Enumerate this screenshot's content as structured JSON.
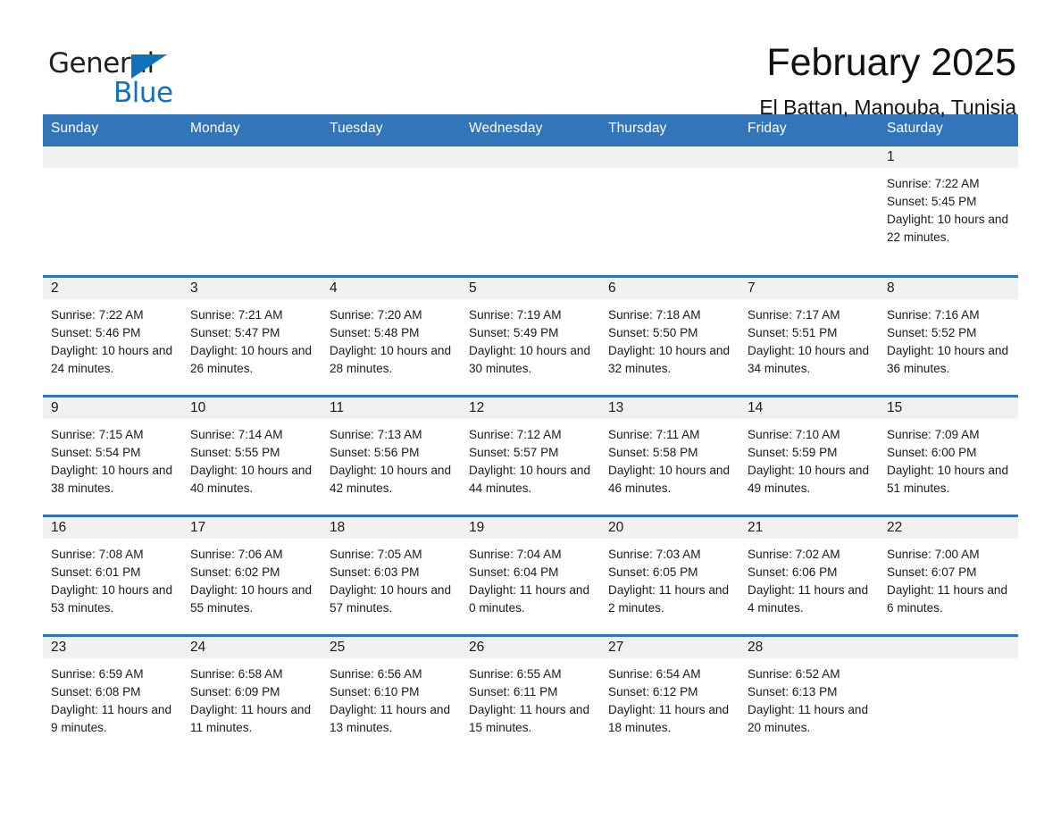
{
  "brand": {
    "name_part1": "General",
    "name_part2": "Blue",
    "triangle_color": "#1271bd"
  },
  "header": {
    "title": "February 2025",
    "location": "El Battan, Manouba, Tunisia"
  },
  "theme": {
    "header_blue": "#3275b8",
    "daynum_band": "#f1f1f1",
    "text": "#1a1a1a"
  },
  "calendar": {
    "weekdays": [
      "Sunday",
      "Monday",
      "Tuesday",
      "Wednesday",
      "Thursday",
      "Friday",
      "Saturday"
    ],
    "weeks": [
      [
        {
          "day": "",
          "sunrise": "",
          "sunset": "",
          "daylight": "",
          "empty": true
        },
        {
          "day": "",
          "sunrise": "",
          "sunset": "",
          "daylight": "",
          "empty": true
        },
        {
          "day": "",
          "sunrise": "",
          "sunset": "",
          "daylight": "",
          "empty": true
        },
        {
          "day": "",
          "sunrise": "",
          "sunset": "",
          "daylight": "",
          "empty": true
        },
        {
          "day": "",
          "sunrise": "",
          "sunset": "",
          "daylight": "",
          "empty": true
        },
        {
          "day": "",
          "sunrise": "",
          "sunset": "",
          "daylight": "",
          "empty": true
        },
        {
          "day": "1",
          "sunrise": "Sunrise: 7:22 AM",
          "sunset": "Sunset: 5:45 PM",
          "daylight": "Daylight: 10 hours and 22 minutes.",
          "empty": false
        }
      ],
      [
        {
          "day": "2",
          "sunrise": "Sunrise: 7:22 AM",
          "sunset": "Sunset: 5:46 PM",
          "daylight": "Daylight: 10 hours and 24 minutes.",
          "empty": false
        },
        {
          "day": "3",
          "sunrise": "Sunrise: 7:21 AM",
          "sunset": "Sunset: 5:47 PM",
          "daylight": "Daylight: 10 hours and 26 minutes.",
          "empty": false
        },
        {
          "day": "4",
          "sunrise": "Sunrise: 7:20 AM",
          "sunset": "Sunset: 5:48 PM",
          "daylight": "Daylight: 10 hours and 28 minutes.",
          "empty": false
        },
        {
          "day": "5",
          "sunrise": "Sunrise: 7:19 AM",
          "sunset": "Sunset: 5:49 PM",
          "daylight": "Daylight: 10 hours and 30 minutes.",
          "empty": false
        },
        {
          "day": "6",
          "sunrise": "Sunrise: 7:18 AM",
          "sunset": "Sunset: 5:50 PM",
          "daylight": "Daylight: 10 hours and 32 minutes.",
          "empty": false
        },
        {
          "day": "7",
          "sunrise": "Sunrise: 7:17 AM",
          "sunset": "Sunset: 5:51 PM",
          "daylight": "Daylight: 10 hours and 34 minutes.",
          "empty": false
        },
        {
          "day": "8",
          "sunrise": "Sunrise: 7:16 AM",
          "sunset": "Sunset: 5:52 PM",
          "daylight": "Daylight: 10 hours and 36 minutes.",
          "empty": false
        }
      ],
      [
        {
          "day": "9",
          "sunrise": "Sunrise: 7:15 AM",
          "sunset": "Sunset: 5:54 PM",
          "daylight": "Daylight: 10 hours and 38 minutes.",
          "empty": false
        },
        {
          "day": "10",
          "sunrise": "Sunrise: 7:14 AM",
          "sunset": "Sunset: 5:55 PM",
          "daylight": "Daylight: 10 hours and 40 minutes.",
          "empty": false
        },
        {
          "day": "11",
          "sunrise": "Sunrise: 7:13 AM",
          "sunset": "Sunset: 5:56 PM",
          "daylight": "Daylight: 10 hours and 42 minutes.",
          "empty": false
        },
        {
          "day": "12",
          "sunrise": "Sunrise: 7:12 AM",
          "sunset": "Sunset: 5:57 PM",
          "daylight": "Daylight: 10 hours and 44 minutes.",
          "empty": false
        },
        {
          "day": "13",
          "sunrise": "Sunrise: 7:11 AM",
          "sunset": "Sunset: 5:58 PM",
          "daylight": "Daylight: 10 hours and 46 minutes.",
          "empty": false
        },
        {
          "day": "14",
          "sunrise": "Sunrise: 7:10 AM",
          "sunset": "Sunset: 5:59 PM",
          "daylight": "Daylight: 10 hours and 49 minutes.",
          "empty": false
        },
        {
          "day": "15",
          "sunrise": "Sunrise: 7:09 AM",
          "sunset": "Sunset: 6:00 PM",
          "daylight": "Daylight: 10 hours and 51 minutes.",
          "empty": false
        }
      ],
      [
        {
          "day": "16",
          "sunrise": "Sunrise: 7:08 AM",
          "sunset": "Sunset: 6:01 PM",
          "daylight": "Daylight: 10 hours and 53 minutes.",
          "empty": false
        },
        {
          "day": "17",
          "sunrise": "Sunrise: 7:06 AM",
          "sunset": "Sunset: 6:02 PM",
          "daylight": "Daylight: 10 hours and 55 minutes.",
          "empty": false
        },
        {
          "day": "18",
          "sunrise": "Sunrise: 7:05 AM",
          "sunset": "Sunset: 6:03 PM",
          "daylight": "Daylight: 10 hours and 57 minutes.",
          "empty": false
        },
        {
          "day": "19",
          "sunrise": "Sunrise: 7:04 AM",
          "sunset": "Sunset: 6:04 PM",
          "daylight": "Daylight: 11 hours and 0 minutes.",
          "empty": false
        },
        {
          "day": "20",
          "sunrise": "Sunrise: 7:03 AM",
          "sunset": "Sunset: 6:05 PM",
          "daylight": "Daylight: 11 hours and 2 minutes.",
          "empty": false
        },
        {
          "day": "21",
          "sunrise": "Sunrise: 7:02 AM",
          "sunset": "Sunset: 6:06 PM",
          "daylight": "Daylight: 11 hours and 4 minutes.",
          "empty": false
        },
        {
          "day": "22",
          "sunrise": "Sunrise: 7:00 AM",
          "sunset": "Sunset: 6:07 PM",
          "daylight": "Daylight: 11 hours and 6 minutes.",
          "empty": false
        }
      ],
      [
        {
          "day": "23",
          "sunrise": "Sunrise: 6:59 AM",
          "sunset": "Sunset: 6:08 PM",
          "daylight": "Daylight: 11 hours and 9 minutes.",
          "empty": false
        },
        {
          "day": "24",
          "sunrise": "Sunrise: 6:58 AM",
          "sunset": "Sunset: 6:09 PM",
          "daylight": "Daylight: 11 hours and 11 minutes.",
          "empty": false
        },
        {
          "day": "25",
          "sunrise": "Sunrise: 6:56 AM",
          "sunset": "Sunset: 6:10 PM",
          "daylight": "Daylight: 11 hours and 13 minutes.",
          "empty": false
        },
        {
          "day": "26",
          "sunrise": "Sunrise: 6:55 AM",
          "sunset": "Sunset: 6:11 PM",
          "daylight": "Daylight: 11 hours and 15 minutes.",
          "empty": false
        },
        {
          "day": "27",
          "sunrise": "Sunrise: 6:54 AM",
          "sunset": "Sunset: 6:12 PM",
          "daylight": "Daylight: 11 hours and 18 minutes.",
          "empty": false
        },
        {
          "day": "28",
          "sunrise": "Sunrise: 6:52 AM",
          "sunset": "Sunset: 6:13 PM",
          "daylight": "Daylight: 11 hours and 20 minutes.",
          "empty": false
        },
        {
          "day": "",
          "sunrise": "",
          "sunset": "",
          "daylight": "",
          "empty": true
        }
      ]
    ]
  }
}
